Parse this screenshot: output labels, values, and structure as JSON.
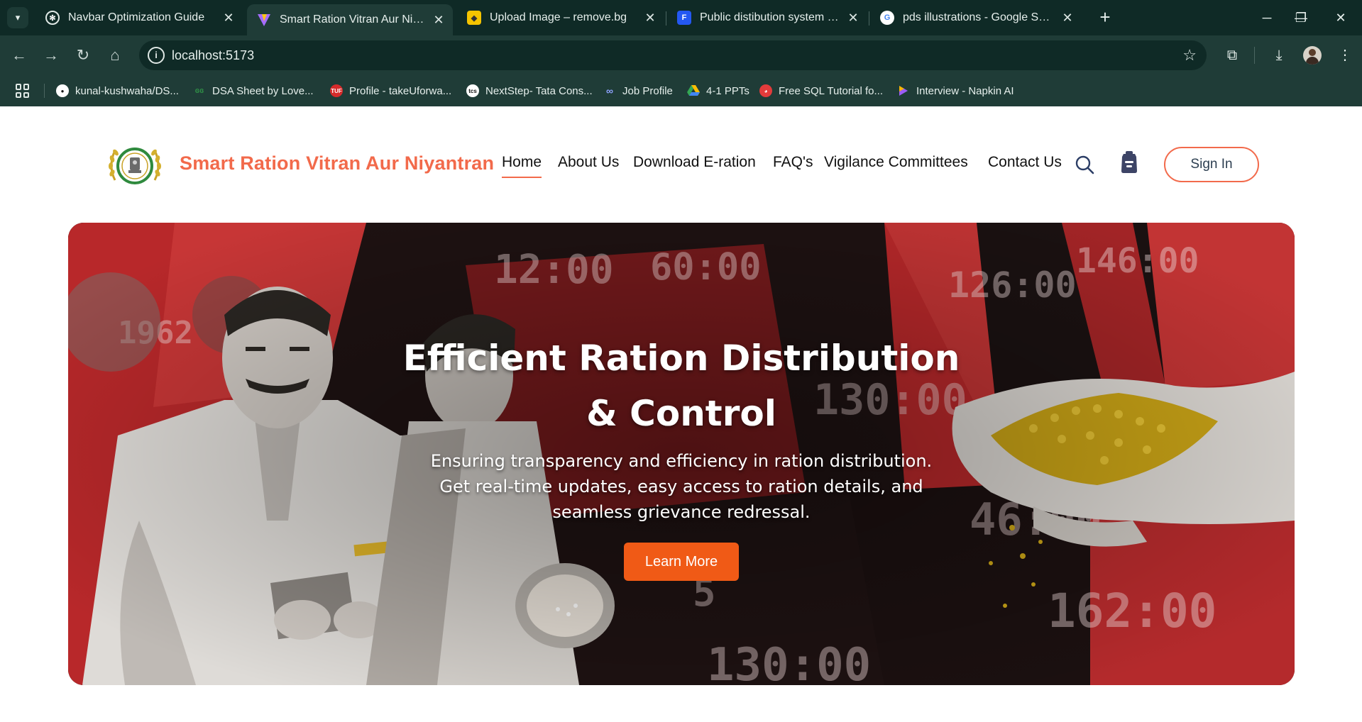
{
  "browser": {
    "tabs": [
      {
        "title": "Navbar Optimization Guide",
        "favicon": "openai-icon",
        "active": false
      },
      {
        "title": "Smart Ration Vitran Aur Niyantran",
        "favicon": "vite-icon",
        "active": true
      },
      {
        "title": "Upload Image – remove.bg",
        "favicon": "removebg-icon",
        "active": false
      },
      {
        "title": "Public distibution system vector",
        "favicon": "freepik-icon",
        "active": false
      },
      {
        "title": "pds illustrations - Google Search",
        "favicon": "google-icon",
        "active": false
      }
    ],
    "new_tab_label": "+",
    "url": "localhost:5173",
    "bookmarks": [
      {
        "label": "kunal-kushwaha/DS...",
        "favicon": "github-icon"
      },
      {
        "label": "DSA Sheet by Love...",
        "favicon": "gfg-icon"
      },
      {
        "label": "Profile - takeUforwa...",
        "favicon": "tuf-icon"
      },
      {
        "label": "NextStep- Tata Cons...",
        "favicon": "tcs-icon"
      },
      {
        "label": "Job Profile",
        "favicon": "link-icon"
      },
      {
        "label": "4-1 PPTs",
        "favicon": "google-drive-icon"
      },
      {
        "label": "Free SQL Tutorial fo...",
        "favicon": "sql-icon"
      },
      {
        "label": "Interview - Napkin AI",
        "favicon": "napkin-icon"
      }
    ]
  },
  "site": {
    "brand": "Smart Ration Vitran Aur Niyantran",
    "nav": [
      {
        "label": "Home",
        "active": true
      },
      {
        "label": "About Us",
        "active": false
      },
      {
        "label": "Download E-ration",
        "active": false
      },
      {
        "label": "FAQ's",
        "active": false
      },
      {
        "label": "Vigilance Committees",
        "active": false
      },
      {
        "label": "Contact Us",
        "active": false
      }
    ],
    "sign_in": "Sign In",
    "accent_color": "#f26a4b",
    "hero": {
      "title_line1": "Efficient Ration Distribution",
      "title_line2": "& Control",
      "subtitle": "Ensuring transparency and efficiency in ration distribution. Get real-time updates, easy access to ration details, and seamless grievance redressal.",
      "cta": "Learn More",
      "cta_color": "#f05a16"
    }
  }
}
